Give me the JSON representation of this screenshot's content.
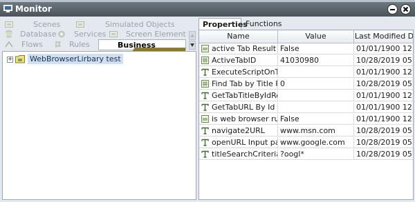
{
  "window": {
    "title": "Monitor"
  },
  "left_tabs": {
    "row1": [
      {
        "label": "Scenes",
        "icon": "scenes-icon"
      },
      {
        "label": "Simulated Objects",
        "icon": "simulated-objects-icon"
      }
    ],
    "row2": [
      {
        "label": "Database",
        "icon": "database-icon"
      },
      {
        "label": "Services",
        "icon": "services-icon"
      },
      {
        "label": "Screen Element",
        "icon": "screen-element-icon"
      }
    ],
    "row3": [
      {
        "label": "Flows",
        "icon": "flows-icon"
      },
      {
        "label": "Rules",
        "icon": "rules-icon"
      }
    ],
    "active": {
      "label": "Business Entities",
      "icon": "business-entities-icon"
    }
  },
  "tree": {
    "items": [
      {
        "label": "WebBrowserLirbary test",
        "expander": "+"
      }
    ]
  },
  "right_tabs": {
    "active": "Properties",
    "inactive": "Functions"
  },
  "grid": {
    "headers": {
      "name": "Name",
      "value": "Value",
      "modified": "Last Modified D"
    },
    "rows": [
      {
        "name": "active Tab Result",
        "value": "False",
        "modified": "01/01/1900 12:",
        "type": "bool"
      },
      {
        "name": "ActiveTabID",
        "value": "41030980",
        "modified": "10/28/2019 05:",
        "type": "number"
      },
      {
        "name": "ExecuteScriptOnTab",
        "value": "",
        "modified": "01/01/1900 12:",
        "type": "text"
      },
      {
        "name": "Find Tab by Title RE",
        "value": "0",
        "modified": "10/28/2019 05:",
        "type": "number"
      },
      {
        "name": "GetTabTitleByIdRes",
        "value": "",
        "modified": "01/01/1900 12:",
        "type": "text"
      },
      {
        "name": "GetTabURL By Id Re",
        "value": "",
        "modified": "01/01/1900 12:",
        "type": "text"
      },
      {
        "name": "is web browser runn",
        "value": "False",
        "modified": "01/01/1900 12:",
        "type": "bool"
      },
      {
        "name": "navigate2URL",
        "value": "www.msn.com",
        "modified": "10/28/2019 05:",
        "type": "text"
      },
      {
        "name": "openURL Input para",
        "value": "www.google.com",
        "modified": "10/28/2019 05:",
        "type": "text"
      },
      {
        "name": "titleSearchCriteria",
        "value": "?oogl*",
        "modified": "10/28/2019 05:",
        "type": "text"
      }
    ]
  }
}
